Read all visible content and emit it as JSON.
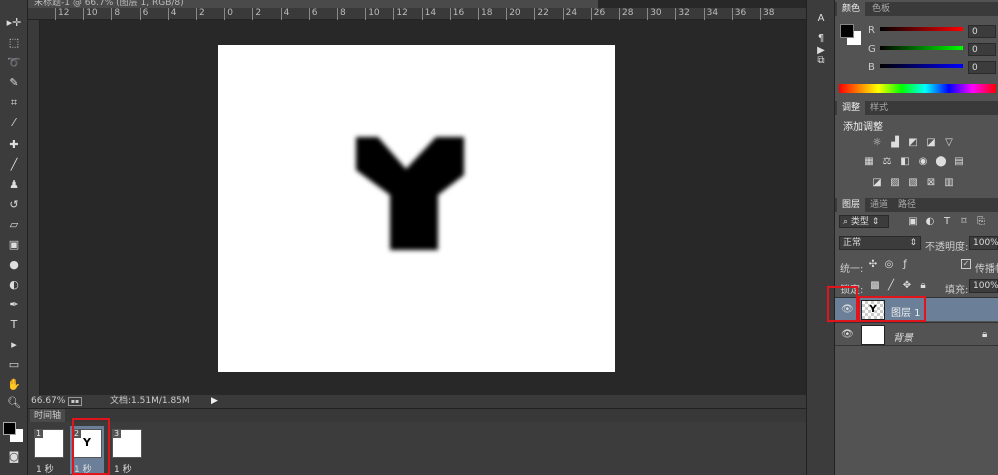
{
  "document": {
    "title": "未标题-1 @ 66.7% (图层 1, RGB/8)",
    "letter": "Y"
  },
  "ruler": {
    "labels": [
      "12",
      "10",
      "8",
      "6",
      "4",
      "2",
      "0",
      "2",
      "4",
      "6",
      "8",
      "10",
      "12",
      "14",
      "16",
      "18",
      "20",
      "22",
      "24",
      "26",
      "28",
      "30",
      "32",
      "34",
      "36",
      "38"
    ]
  },
  "status": {
    "zoom": "66.67%",
    "doc_info": "文档:1.51M/1.85M"
  },
  "timeline": {
    "title": "时间轴",
    "frames": [
      {
        "num": "1",
        "duration": "1 秒"
      },
      {
        "num": "2",
        "duration": "1 秒"
      },
      {
        "num": "3",
        "duration": "1 秒"
      }
    ]
  },
  "color_panel": {
    "tabs": [
      "颜色",
      "色板"
    ],
    "r_label": "R",
    "g_label": "G",
    "b_label": "B",
    "r": "0",
    "g": "0",
    "b": "0"
  },
  "adjust_panel": {
    "tabs": [
      "调整",
      "样式"
    ],
    "heading": "添加调整"
  },
  "layers_panel": {
    "tabs": [
      "图层",
      "通道",
      "路径"
    ],
    "filter": "类型",
    "blend_mode": "正常",
    "opacity_label": "不透明度:",
    "opacity": "100%",
    "unify_label": "统一:",
    "propagate_label": "传播帧",
    "lock_label": "锁定:",
    "fill_label": "填充:",
    "fill": "100%",
    "layers": [
      {
        "name": "图层 1"
      },
      {
        "name": "背景"
      }
    ]
  },
  "colors": {
    "highlight": "#e0141b",
    "selected_layer": "#6b7f99"
  }
}
